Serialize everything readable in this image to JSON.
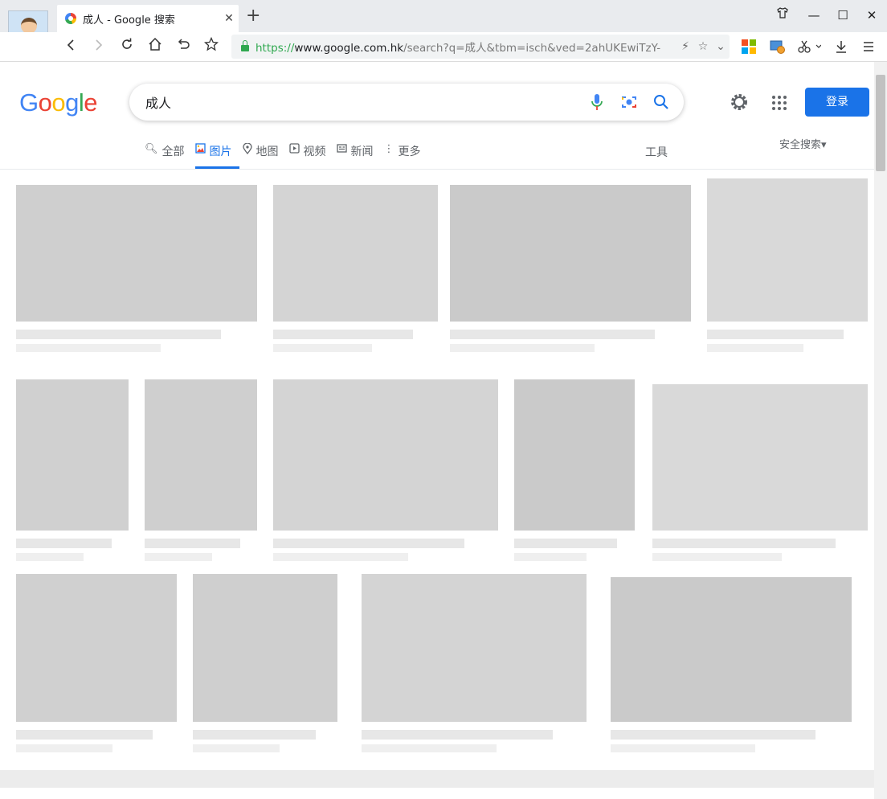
{
  "browser": {
    "tab_title": "成人 - Google 搜索",
    "tab_close": "✕",
    "new_tab": "+",
    "window_buttons": {
      "shirt": "⌂",
      "minimize": "—",
      "maximize": "☐",
      "close": "✕"
    },
    "url_scheme": "https://",
    "url_host": "www.google.com.hk",
    "url_path": "/search?q=成人&tbm=isch&ved=2ahUKEwiTzY-",
    "toolbar_icons": [
      "back-icon",
      "forward-icon",
      "reload-icon",
      "home-icon",
      "undo-icon",
      "star-icon"
    ],
    "colors": {
      "ssl_green": "#2fa84f",
      "tabbar": "#e9ebee"
    }
  },
  "google": {
    "logo_letters": [
      "G",
      "o",
      "o",
      "g",
      "l",
      "e"
    ],
    "logo_colors": [
      "#4285f4",
      "#ea4335",
      "#fbbc05",
      "#4285f4",
      "#34a853",
      "#ea4335"
    ],
    "query": "成人",
    "login_label": "登录",
    "tools_label": "工具",
    "safesearch_label": "安全搜索▾",
    "accent": "#1a73e8"
  },
  "nav": {
    "tabs": [
      {
        "label": "全部",
        "icon": "search-icon",
        "active": false
      },
      {
        "label": "图片",
        "icon": "image-icon",
        "active": true
      },
      {
        "label": "地图",
        "icon": "map-pin-icon",
        "active": false
      },
      {
        "label": "视频",
        "icon": "video-icon",
        "active": false
      },
      {
        "label": "新闻",
        "icon": "news-icon",
        "active": false
      },
      {
        "label": "更多",
        "icon": "more-vert-icon",
        "active": false
      }
    ]
  },
  "results": {
    "tile_count": 13,
    "note": ""
  }
}
